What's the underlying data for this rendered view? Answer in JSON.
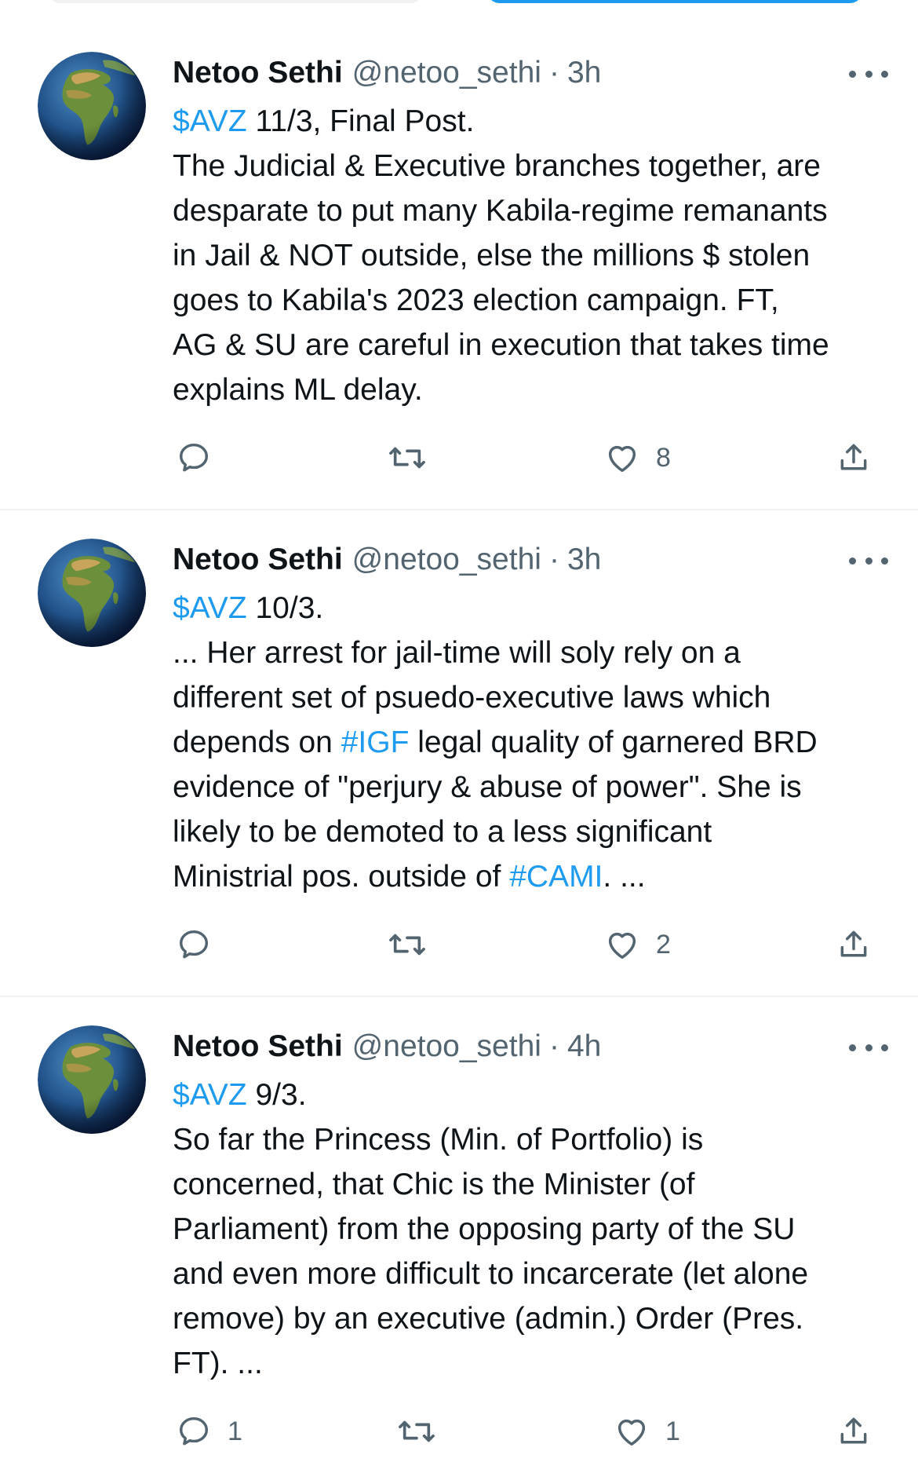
{
  "theme": {
    "accent": "#1d9bf0",
    "text": "#0f1419",
    "muted": "#536471",
    "divider": "#eff3f4"
  },
  "tweets": [
    {
      "name": "Netoo Sethi",
      "handle": "@netoo_sethi",
      "sep": "·",
      "time": "3h",
      "lines": [
        [
          "$AVZ",
          " 11/3, Final Post."
        ],
        [
          "The Judicial & Executive branches together, are"
        ],
        [
          "desparate to put many Kabila-regime remanants"
        ],
        [
          "in Jail & NOT outside, else the millions $ stolen"
        ],
        [
          "goes to Kabila's 2023 election campaign. FT,"
        ],
        [
          "AG & SU are careful in execution that takes time"
        ],
        [
          "explains ML delay."
        ]
      ],
      "reply_count": "",
      "retweet_count": "",
      "like_count": "8"
    },
    {
      "name": "Netoo Sethi",
      "handle": "@netoo_sethi",
      "sep": "·",
      "time": "3h",
      "lines": [
        [
          "$AVZ",
          " 10/3."
        ],
        [
          "... Her arrest for jail-time will soly rely on a"
        ],
        [
          "different set of psuedo-executive laws which"
        ],
        [
          "depends on ",
          "#IGF",
          " legal quality of garnered BRD"
        ],
        [
          "evidence of \"perjury & abuse of power\". She is"
        ],
        [
          "likely to be demoted to a less significant"
        ],
        [
          "Ministrial pos. outside of ",
          "#CAMI",
          ". ..."
        ]
      ],
      "reply_count": "",
      "retweet_count": "",
      "like_count": "2"
    },
    {
      "name": "Netoo Sethi",
      "handle": "@netoo_sethi",
      "sep": "·",
      "time": "4h",
      "lines": [
        [
          "$AVZ",
          " 9/3."
        ],
        [
          "So far the Princess (Min. of Portfolio) is"
        ],
        [
          "concerned, that Chic is the Minister (of"
        ],
        [
          "Parliament) from the opposing party of the SU"
        ],
        [
          "and even more difficult to incarcerate (let alone"
        ],
        [
          "remove) by an executive (admin.) Order (Pres."
        ],
        [
          "FT). ..."
        ]
      ],
      "reply_count": "1",
      "retweet_count": "",
      "like_count": "1"
    }
  ],
  "link_segments": [
    "$AVZ",
    "#IGF",
    "#CAMI"
  ],
  "icons": {
    "avatar": "earth-globe-icon",
    "more": "more-dots-icon",
    "reply": "reply-bubble-icon",
    "retweet": "retweet-icon",
    "like": "heart-icon",
    "share": "share-upload-icon"
  }
}
